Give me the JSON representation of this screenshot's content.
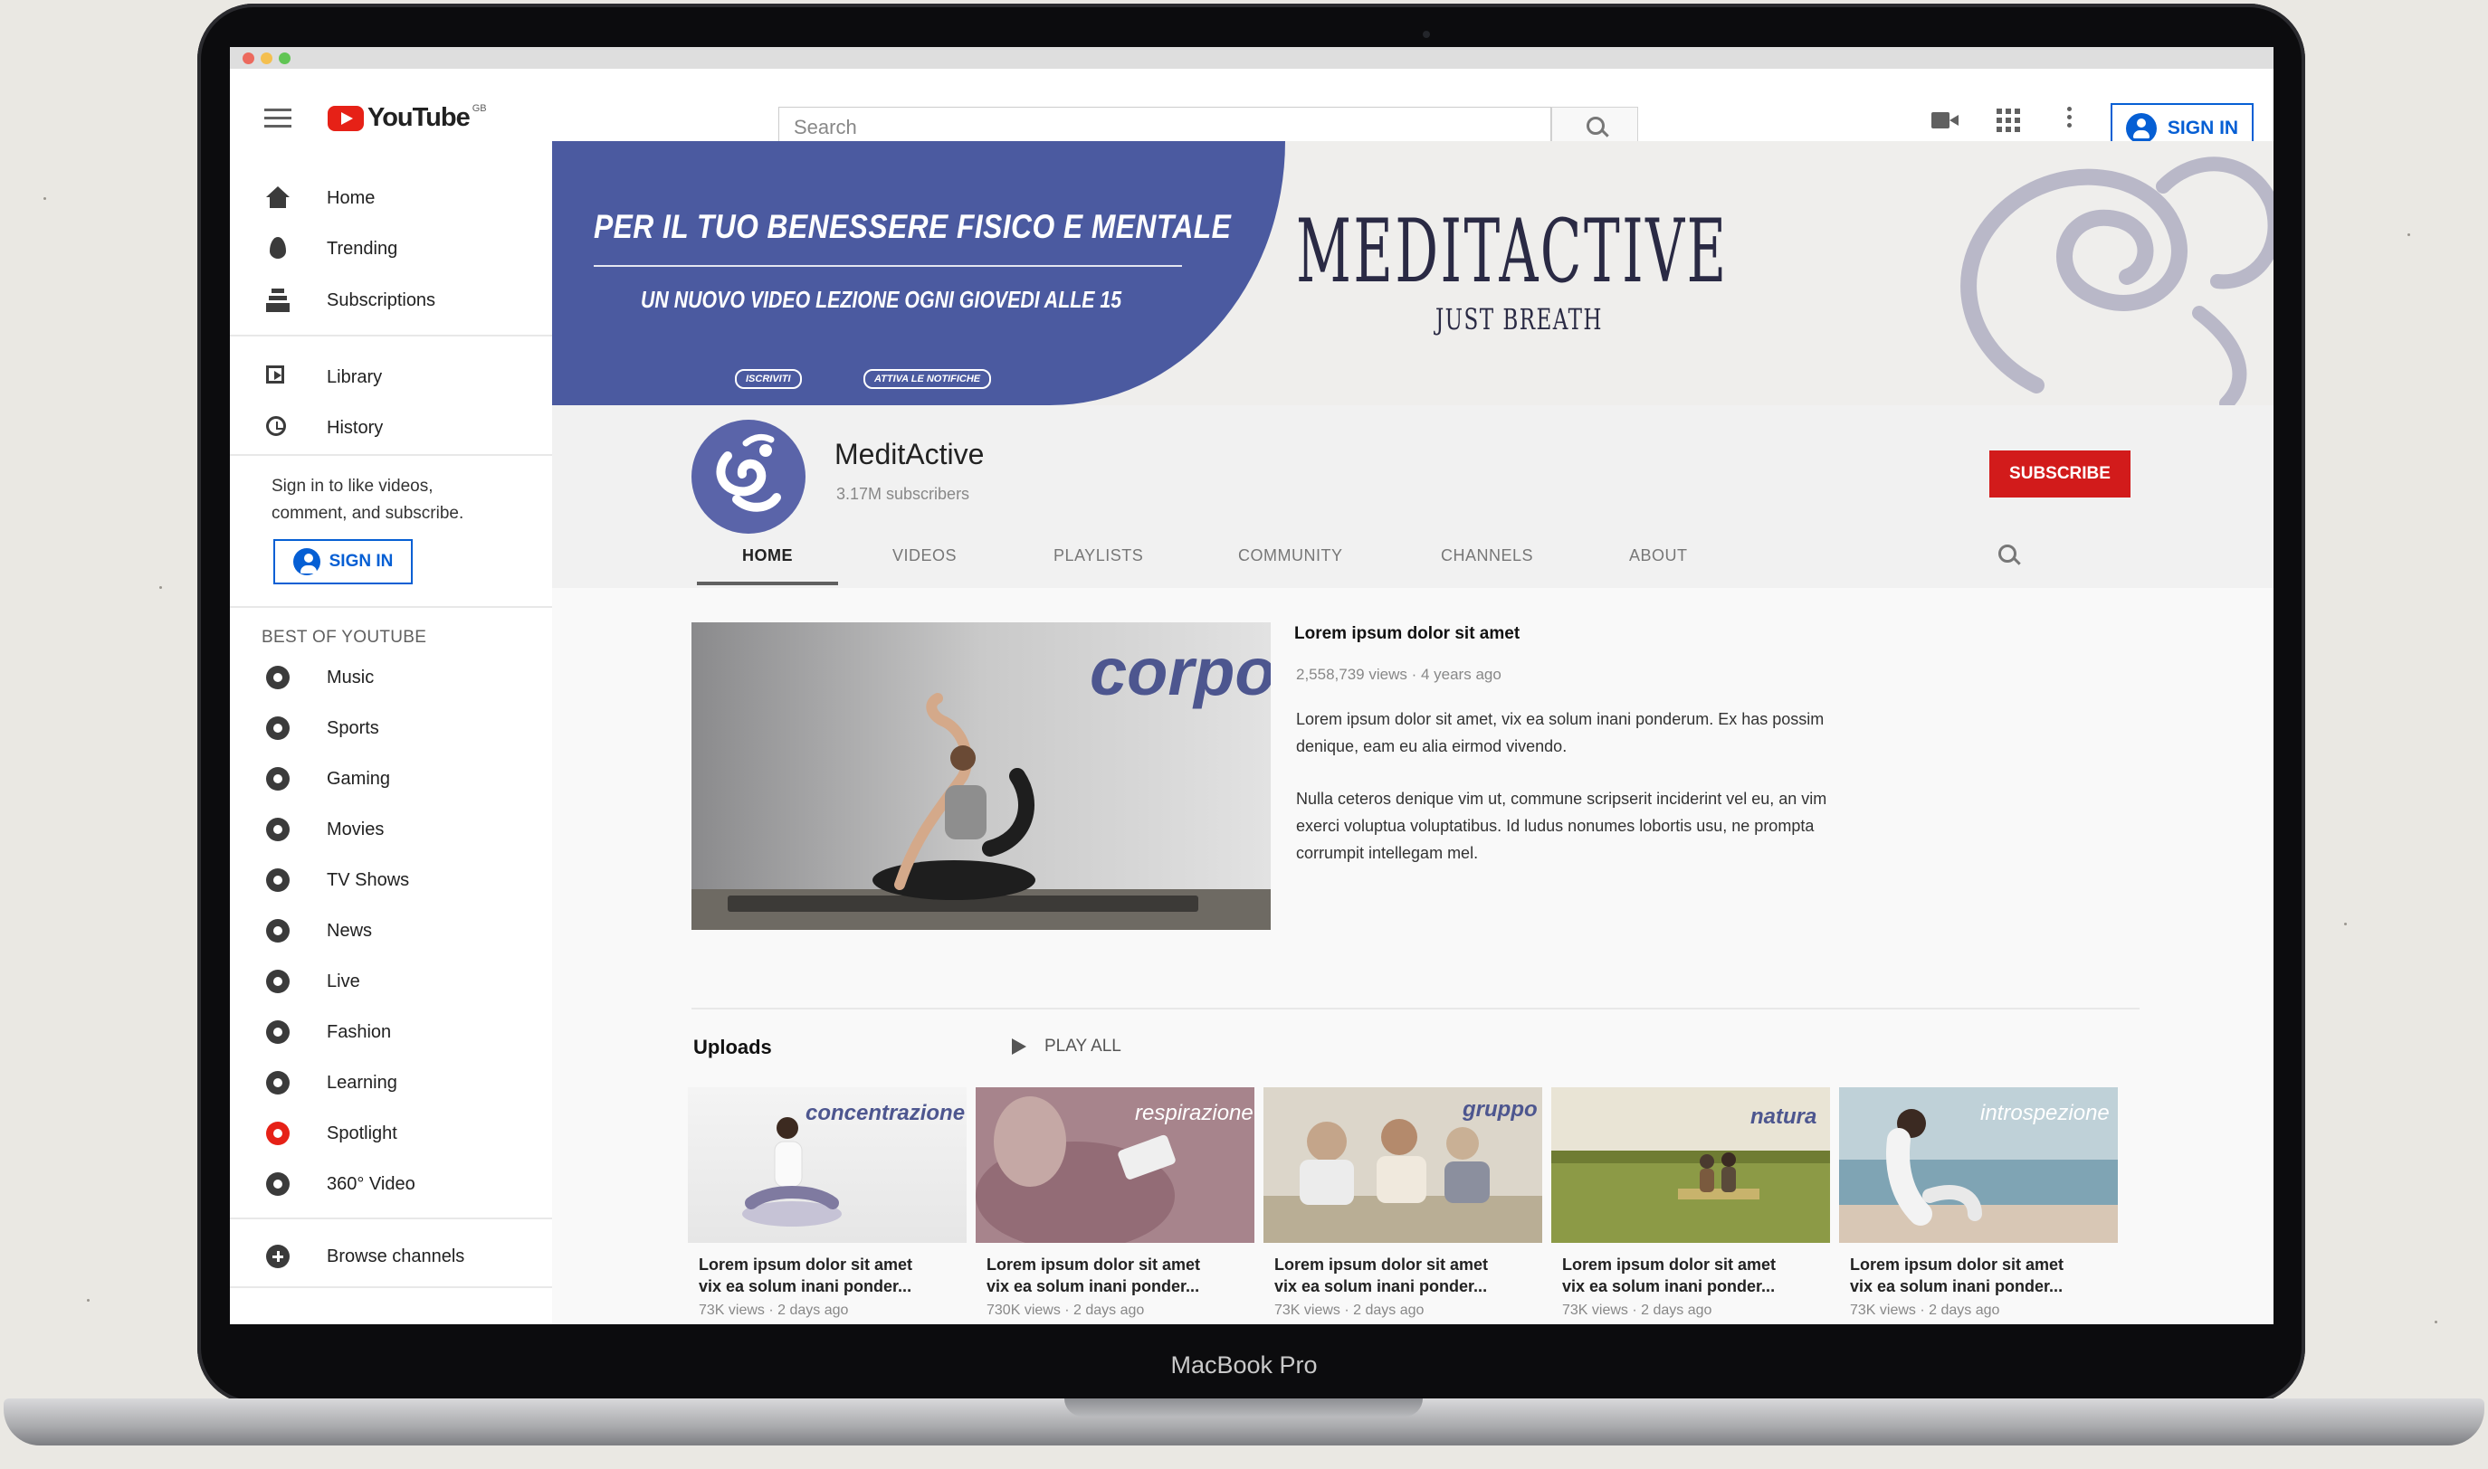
{
  "laptop_label": "MacBook Pro",
  "topbar": {
    "logo_text": "YouTube",
    "logo_region": "GB",
    "search_placeholder": "Search",
    "sign_in_label": "SIGN IN"
  },
  "sidebar": {
    "main_items": [
      {
        "label": "Home",
        "icon": "home-icon"
      },
      {
        "label": "Trending",
        "icon": "trending-icon"
      },
      {
        "label": "Subscriptions",
        "icon": "subscriptions-icon"
      }
    ],
    "library_items": [
      {
        "label": "Library",
        "icon": "library-icon"
      },
      {
        "label": "History",
        "icon": "history-icon"
      }
    ],
    "sign_in_note": "Sign in to like videos, comment, and subscribe.",
    "sign_in_label": "SIGN IN",
    "section_title": "BEST OF YOUTUBE",
    "best_items": [
      {
        "label": "Music",
        "icon": "music-icon"
      },
      {
        "label": "Sports",
        "icon": "sports-icon"
      },
      {
        "label": "Gaming",
        "icon": "gaming-icon"
      },
      {
        "label": "Movies",
        "icon": "movies-icon"
      },
      {
        "label": "TV Shows",
        "icon": "tv-icon"
      },
      {
        "label": "News",
        "icon": "news-icon"
      },
      {
        "label": "Live",
        "icon": "live-icon"
      },
      {
        "label": "Fashion",
        "icon": "fashion-icon"
      },
      {
        "label": "Learning",
        "icon": "learning-icon"
      },
      {
        "label": "Spotlight",
        "icon": "spotlight-icon"
      },
      {
        "label": "360° Video",
        "icon": "360-video-icon"
      }
    ],
    "browse_label": "Browse channels"
  },
  "banner": {
    "headline": "PER IL TUO BENESSERE FISICO E MENTALE",
    "subline": "UN NUOVO VIDEO LEZIONE OGNI GIOVEDI ALLE 15",
    "pill1": "ISCRIVITI",
    "pill2": "ATTIVA LE NOTIFICHE",
    "brand": "MEDITACTIVE",
    "tagline": "JUST BREATH"
  },
  "channel": {
    "name": "MeditActive",
    "subscribers": "3.17M subscribers",
    "subscribe_label": "SUBSCRIBE",
    "tabs": [
      "HOME",
      "VIDEOS",
      "PLAYLISTS",
      "COMMUNITY",
      "CHANNELS",
      "ABOUT"
    ],
    "active_tab": "HOME"
  },
  "featured": {
    "thumb_text": "corpo",
    "title": "Lorem ipsum dolor sit amet",
    "meta": "2,558,739 views · 4 years ago",
    "desc1": "Lorem ipsum dolor sit amet, vix ea solum inani ponderum. Ex has possim denique, eam eu alia eirmod vivendo.",
    "desc2": "Nulla ceteros denique vim ut, commune scripserit inciderint vel eu, an vim exerci voluptua voluptatibus. Id ludus nonumes lobortis usu, ne prompta corrumpit intellegam mel."
  },
  "uploads": {
    "title": "Uploads",
    "play_all": "PLAY ALL",
    "videos": [
      {
        "thumb_text": "concentrazione",
        "title1": "Lorem ipsum dolor sit amet",
        "title2": "vix ea solum inani ponder...",
        "meta": "73K views · 2 days ago"
      },
      {
        "thumb_text": "respirazione",
        "title1": "Lorem ipsum dolor sit amet",
        "title2": "vix ea solum inani ponder...",
        "meta": "730K views · 2 days ago"
      },
      {
        "thumb_text": "gruppo",
        "title1": "Lorem ipsum dolor sit amet",
        "title2": "vix ea solum inani ponder...",
        "meta": "73K views · 2 days ago"
      },
      {
        "thumb_text": "natura",
        "title1": "Lorem ipsum dolor sit amet",
        "title2": "vix ea solum inani ponder...",
        "meta": "73K views · 2 days ago"
      },
      {
        "thumb_text": "introspezione",
        "title1": "Lorem ipsum dolor sit amet",
        "title2": "vix ea solum inani ponder...",
        "meta": "73K views · 2 days ago"
      }
    ]
  },
  "colors": {
    "brand_blue": "#4b5aa0",
    "subscribe_red": "#d21b1b",
    "youtube_red": "#e62117",
    "link_blue": "#065fd4"
  }
}
